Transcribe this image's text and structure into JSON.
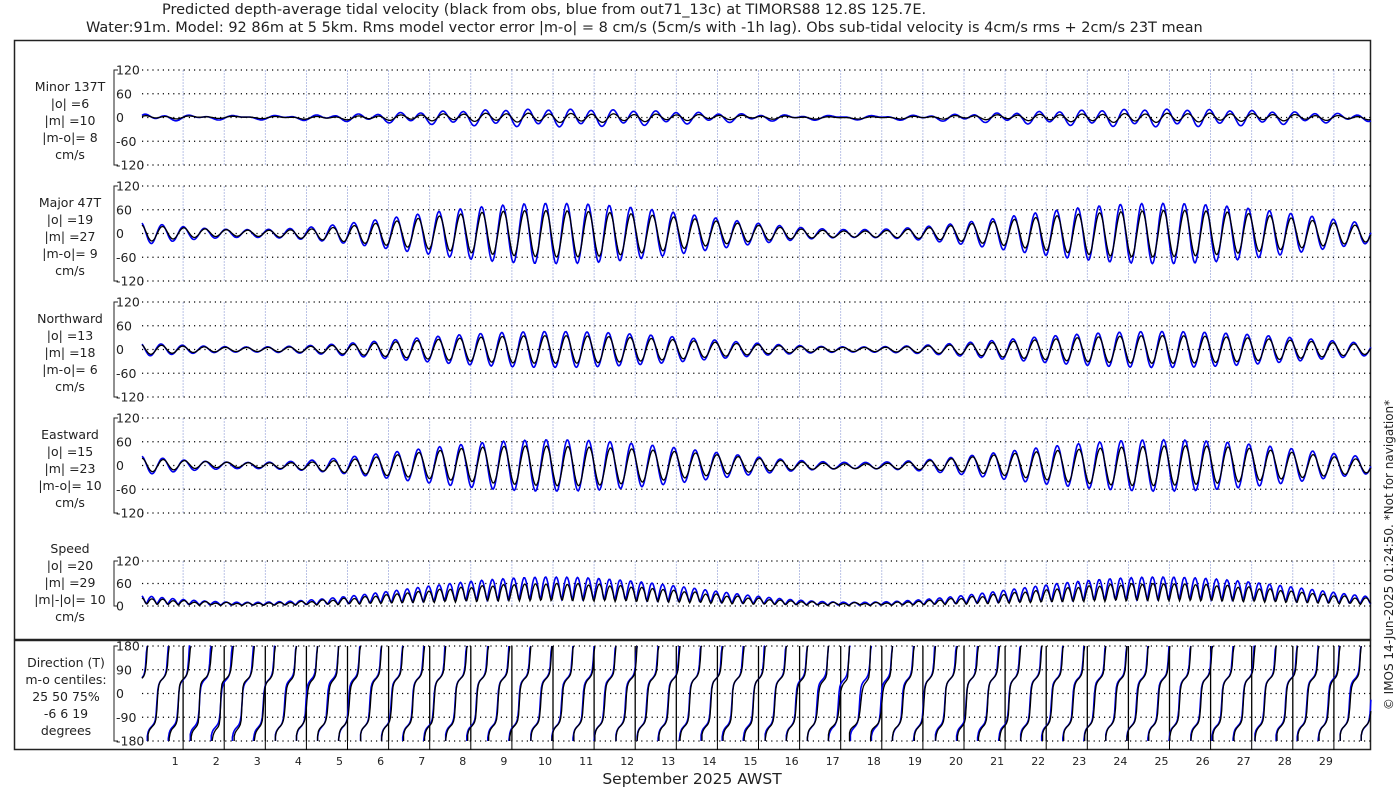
{
  "title_line1": "Predicted depth-average tidal velocity (black from obs, blue from out71_13c) at TIMORS88 12.8S 125.7E.",
  "title_line2": "Water:91m. Model: 92 86m at 5 5km. Rms model vector error |m-o| = 8 cm/s (5cm/s with -1h lag). Obs sub-tidal velocity is 4cm/s rms + 2cm/s 23T mean",
  "copyright": "© IMOS 14-Jun-2025 01:24:50. *Not for navigation*",
  "colors": {
    "obs": "#000000",
    "model": "#0000ee",
    "grid": "#000000",
    "day_grid": "#aab4e0"
  },
  "chart_data": {
    "type": "line",
    "xlabel": "September 2025 AWST",
    "x_ticks": [
      "1",
      "2",
      "3",
      "4",
      "5",
      "6",
      "7",
      "8",
      "9",
      "10",
      "11",
      "12",
      "13",
      "14",
      "15",
      "16",
      "17",
      "18",
      "19",
      "20",
      "21",
      "22",
      "23",
      "24",
      "25",
      "26",
      "27",
      "28",
      "29"
    ],
    "xlim_days": [
      0,
      30
    ],
    "legend": "in title: black = obs, blue = model",
    "panels": [
      {
        "key": "minor",
        "labels": [
          "Minor 137T",
          "|o| =6",
          "|m| =10",
          "|m-o|= 8",
          "cm/s"
        ],
        "ylim": [
          -120,
          120
        ],
        "yticks": [
          "120",
          "60",
          "0",
          "-60",
          "-120"
        ],
        "obs_amp": 8,
        "model_amp": 13
      },
      {
        "key": "major",
        "labels": [
          "Major 47T",
          "|o| =19",
          "|m| =27",
          "|m-o|= 9",
          "cm/s"
        ],
        "ylim": [
          -120,
          120
        ],
        "yticks": [
          "120",
          "60",
          "0",
          "-60",
          "-120"
        ],
        "obs_amp": 30,
        "model_amp": 40
      },
      {
        "key": "north",
        "labels": [
          "Northward",
          "|o| =13",
          "|m| =18",
          "|m-o|= 6",
          "cm/s"
        ],
        "ylim": [
          -120,
          120
        ],
        "yticks": [
          "120",
          "60",
          "0",
          "-60",
          "-120"
        ],
        "obs_amp": 22,
        "model_amp": 28
      },
      {
        "key": "east",
        "labels": [
          "Eastward",
          "|o| =15",
          "|m| =23",
          "|m-o|= 10",
          "cm/s"
        ],
        "ylim": [
          -120,
          120
        ],
        "yticks": [
          "120",
          "60",
          "0",
          "-60",
          "-120"
        ],
        "obs_amp": 25,
        "model_amp": 34
      },
      {
        "key": "speed",
        "labels": [
          "Speed",
          "|o| =20",
          "|m| =29",
          "|m|-|o|= 10",
          "cm/s"
        ],
        "ylim": [
          0,
          120
        ],
        "yticks": [
          "120",
          "60",
          "0"
        ]
      },
      {
        "key": "dir",
        "labels": [
          "Direction (T)",
          "m-o centiles:",
          "25  50  75%",
          "-6   6  19",
          "degrees"
        ],
        "ylim": [
          -180,
          180
        ],
        "yticks": [
          "180",
          "90",
          "0",
          "-90",
          "-180"
        ]
      }
    ],
    "tide": {
      "cycles_per_day": 1.93,
      "spring_days": [
        10,
        24.8
      ],
      "neap_days": [
        2.6,
        17.4
      ]
    }
  }
}
